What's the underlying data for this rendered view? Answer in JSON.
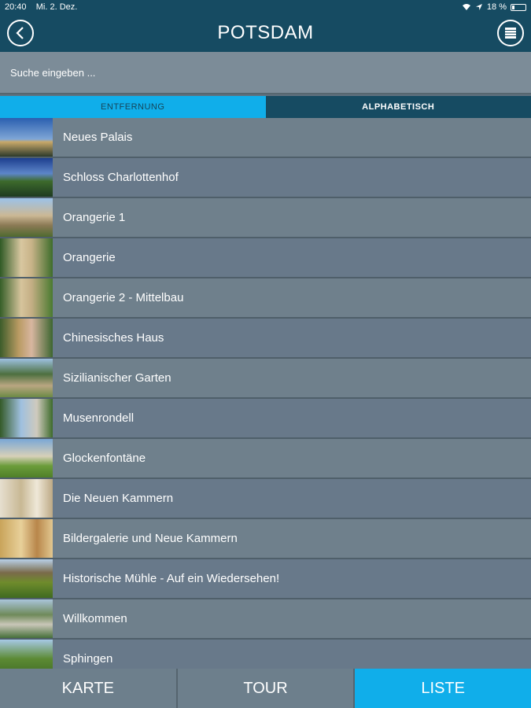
{
  "status": {
    "time": "20:40",
    "date": "Mi. 2. Dez.",
    "battery": "18 %",
    "battery_level": 0.18
  },
  "header": {
    "title": "POTSDAM",
    "back_icon": "back-arrow-icon",
    "menu_icon": "list-menu-icon"
  },
  "search": {
    "placeholder": "Suche eingeben ..."
  },
  "tabs": [
    {
      "label": "ENTFERNUNG",
      "active": true
    },
    {
      "label": "ALPHABETISCH",
      "active": false
    }
  ],
  "items": [
    {
      "label": "Neues Palais"
    },
    {
      "label": "Schloss Charlottenhof"
    },
    {
      "label": "Orangerie 1"
    },
    {
      "label": "Orangerie"
    },
    {
      "label": "Orangerie 2 - Mittelbau"
    },
    {
      "label": "Chinesisches Haus"
    },
    {
      "label": "Sizilianischer Garten"
    },
    {
      "label": "Musenrondell"
    },
    {
      "label": "Glockenfontäne"
    },
    {
      "label": "Die Neuen Kammern"
    },
    {
      "label": "Bildergalerie und Neue Kammern"
    },
    {
      "label": "Historische Mühle - Auf ein Wiedersehen!"
    },
    {
      "label": "Willkommen"
    },
    {
      "label": "Sphingen"
    }
  ],
  "bottom_nav": [
    {
      "label": "KARTE",
      "active": false
    },
    {
      "label": "TOUR",
      "active": false
    },
    {
      "label": "LISTE",
      "active": true
    }
  ],
  "colors": {
    "header": "#164b62",
    "accent": "#10aeea",
    "row": "#6f808c"
  }
}
